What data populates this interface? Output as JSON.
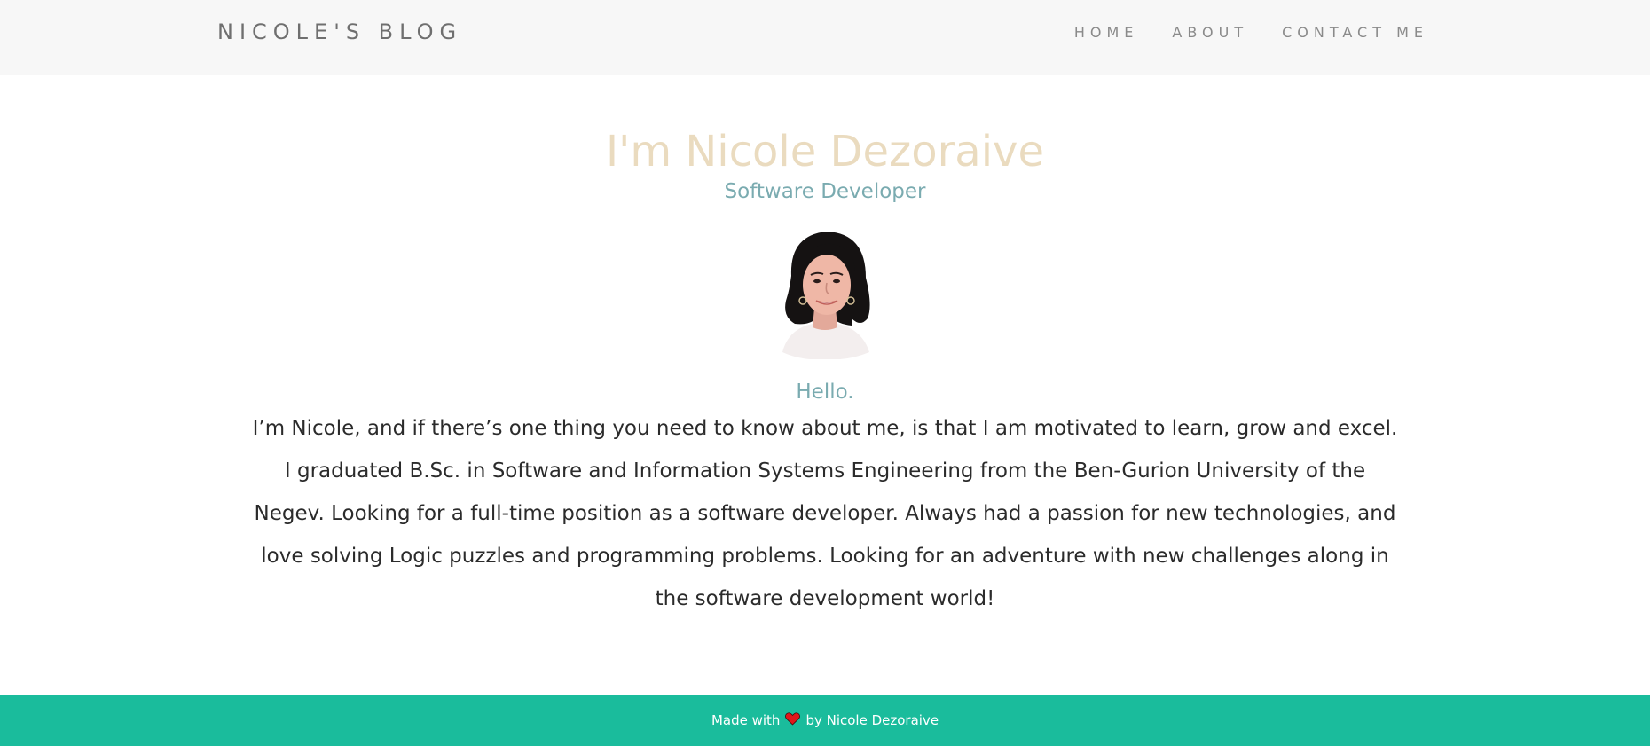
{
  "navbar": {
    "brand": "NICOLE'S BLOG",
    "links": [
      "HOME",
      "ABOUT",
      "CONTACT ME"
    ]
  },
  "hero": {
    "title": "I'm Nicole Dezoraive",
    "subtitle": "Software Developer",
    "avatar_icon": "profile-photo",
    "greeting": "Hello.",
    "bio": "I’m Nicole, and if there’s one thing you need to know about me, is that I am motivated to learn, grow and excel. I graduated B.Sc. in Software and Information Systems Engineering from the Ben-Gurion University of the Negev. Looking for a full-time position as a software developer. Always had a passion for new technologies, and love solving Logic puzzles and programming problems. Looking for an adventure with new challenges along in the software development world!"
  },
  "footer": {
    "prefix": "Made with",
    "icon": "heart-icon",
    "suffix": "by Nicole Dezoraive"
  },
  "colors": {
    "navbar_bg": "#f7f7f7",
    "title": "#eadbbf",
    "accent": "#7aabb0",
    "footer_bg": "#1abc9c",
    "heart": "#e0161a"
  }
}
